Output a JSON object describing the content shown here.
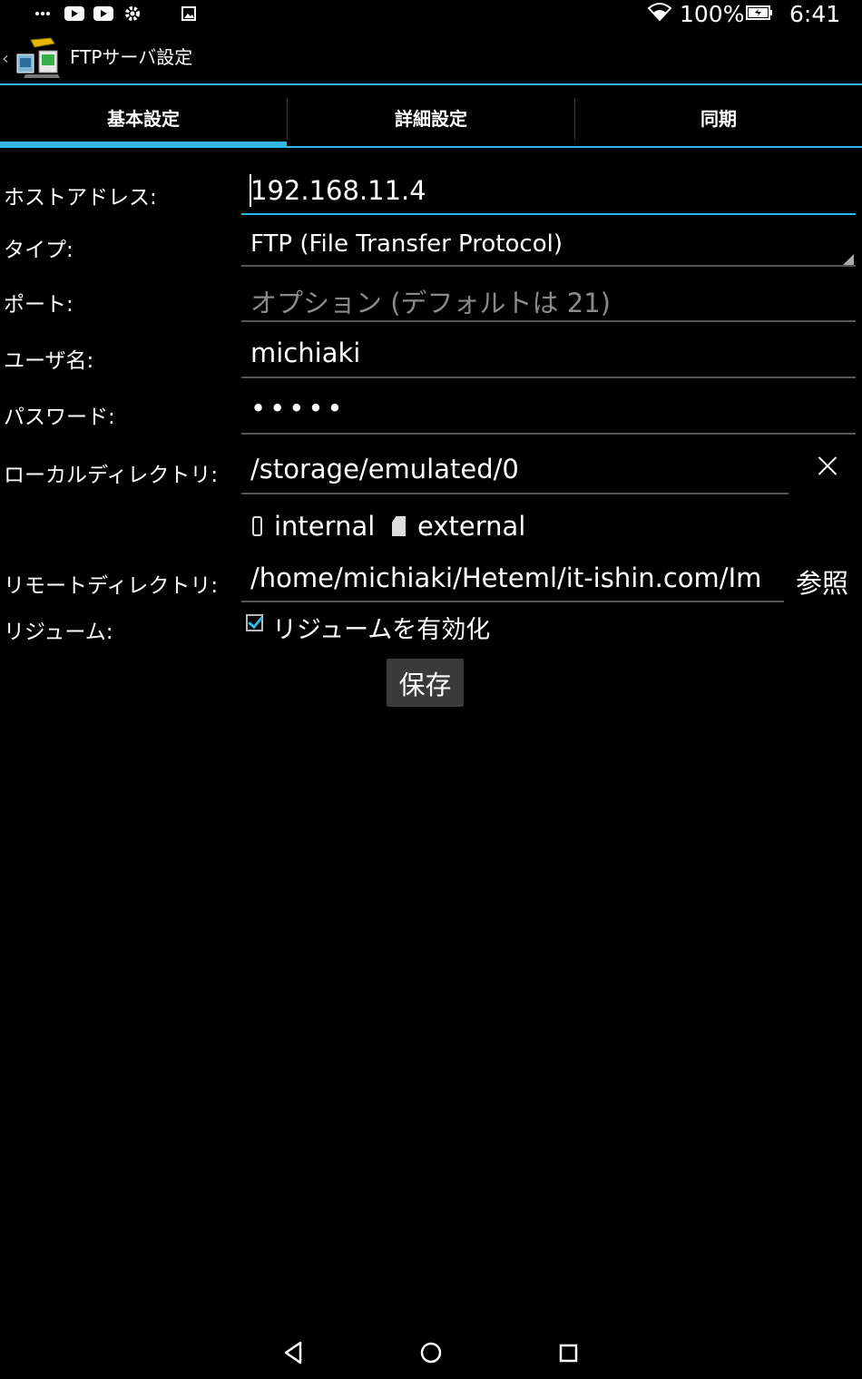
{
  "status_bar": {
    "battery_percent": "100%",
    "time": "6:41",
    "left_icons": [
      "more-icon",
      "youtube-icon",
      "youtube-icon",
      "settings-icon",
      "image-icon"
    ],
    "right_icons": [
      "wifi-icon",
      "battery-icon"
    ]
  },
  "action_bar": {
    "title": "FTPサーバ設定",
    "icon": "ftp-app-icon"
  },
  "tabs": [
    {
      "label": "基本設定",
      "active": true
    },
    {
      "label": "詳細設定",
      "active": false
    },
    {
      "label": "同期",
      "active": false
    }
  ],
  "form": {
    "host": {
      "label": "ホストアドレス:",
      "value": "192.168.11.4"
    },
    "type": {
      "label": "タイプ:",
      "value": "FTP (File Transfer Protocol)"
    },
    "port": {
      "label": "ポート:",
      "placeholder": "オプション (デフォルトは 21)"
    },
    "username": {
      "label": "ユーザ名:",
      "value": "michiaki"
    },
    "password": {
      "label": "パスワード:",
      "value": "•••••"
    },
    "local_dir": {
      "label": "ローカルディレクトリ:",
      "value": "/storage/emulated/0"
    },
    "storage_options": {
      "internal": "internal",
      "external": "external"
    },
    "remote_dir": {
      "label": "リモートディレクトリ:",
      "value": "/home/michiaki/Heteml/it-ishin.com/Im",
      "browse": "参照"
    },
    "resume": {
      "label": "リジューム:",
      "checkbox_label": "リジュームを有効化",
      "checked": true
    }
  },
  "save_button": "保存",
  "colors": {
    "accent": "#33b5e5",
    "background": "#000000"
  }
}
